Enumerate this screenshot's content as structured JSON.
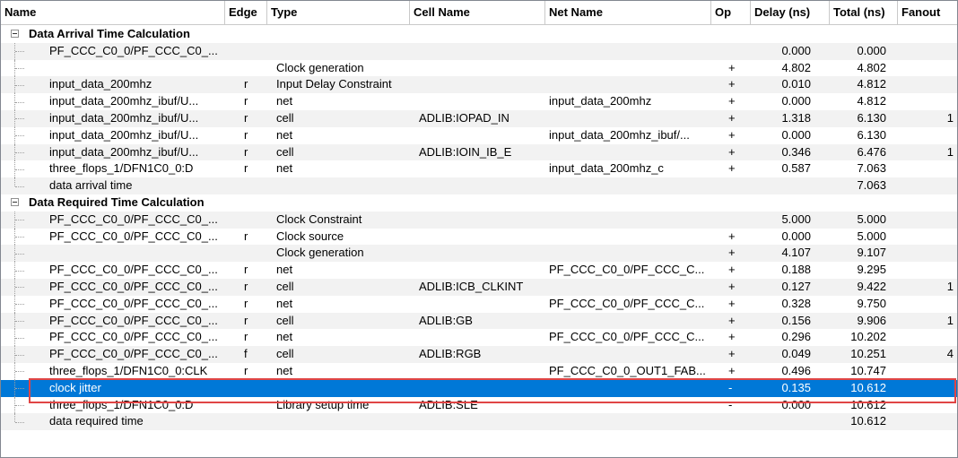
{
  "columns": [
    "Name",
    "Edge",
    "Type",
    "Cell Name",
    "Net Name",
    "Op",
    "Delay (ns)",
    "Total (ns)",
    "Fanout"
  ],
  "groups": [
    {
      "label": "Data Arrival Time Calculation",
      "rows": [
        {
          "name": "PF_CCC_C0_0/PF_CCC_C0_...",
          "edge": "",
          "type": "",
          "cell": "",
          "net": "",
          "op": "",
          "delay": "0.000",
          "total": "0.000",
          "fanout": ""
        },
        {
          "name": "",
          "edge": "",
          "type": "Clock generation",
          "cell": "",
          "net": "",
          "op": "+",
          "delay": "4.802",
          "total": "4.802",
          "fanout": ""
        },
        {
          "name": "input_data_200mhz",
          "edge": "r",
          "type": "Input Delay Constraint",
          "cell": "",
          "net": "",
          "op": "+",
          "delay": "0.010",
          "total": "4.812",
          "fanout": ""
        },
        {
          "name": "input_data_200mhz_ibuf/U...",
          "edge": "r",
          "type": "net",
          "cell": "",
          "net": "input_data_200mhz",
          "op": "+",
          "delay": "0.000",
          "total": "4.812",
          "fanout": ""
        },
        {
          "name": "input_data_200mhz_ibuf/U...",
          "edge": "r",
          "type": "cell",
          "cell": "ADLIB:IOPAD_IN",
          "net": "",
          "op": "+",
          "delay": "1.318",
          "total": "6.130",
          "fanout": "1"
        },
        {
          "name": "input_data_200mhz_ibuf/U...",
          "edge": "r",
          "type": "net",
          "cell": "",
          "net": "input_data_200mhz_ibuf/...",
          "op": "+",
          "delay": "0.000",
          "total": "6.130",
          "fanout": ""
        },
        {
          "name": "input_data_200mhz_ibuf/U...",
          "edge": "r",
          "type": "cell",
          "cell": "ADLIB:IOIN_IB_E",
          "net": "",
          "op": "+",
          "delay": "0.346",
          "total": "6.476",
          "fanout": "1"
        },
        {
          "name": "three_flops_1/DFN1C0_0:D",
          "edge": "r",
          "type": "net",
          "cell": "",
          "net": "input_data_200mhz_c",
          "op": "+",
          "delay": "0.587",
          "total": "7.063",
          "fanout": ""
        },
        {
          "name": "data arrival time",
          "edge": "",
          "type": "",
          "cell": "",
          "net": "",
          "op": "",
          "delay": "",
          "total": "7.063",
          "fanout": ""
        }
      ]
    },
    {
      "label": "Data Required Time Calculation",
      "rows": [
        {
          "name": "PF_CCC_C0_0/PF_CCC_C0_...",
          "edge": "",
          "type": "Clock Constraint",
          "cell": "",
          "net": "",
          "op": "",
          "delay": "5.000",
          "total": "5.000",
          "fanout": ""
        },
        {
          "name": "PF_CCC_C0_0/PF_CCC_C0_...",
          "edge": "r",
          "type": "Clock source",
          "cell": "",
          "net": "",
          "op": "+",
          "delay": "0.000",
          "total": "5.000",
          "fanout": ""
        },
        {
          "name": "",
          "edge": "",
          "type": "Clock generation",
          "cell": "",
          "net": "",
          "op": "+",
          "delay": "4.107",
          "total": "9.107",
          "fanout": ""
        },
        {
          "name": "PF_CCC_C0_0/PF_CCC_C0_...",
          "edge": "r",
          "type": "net",
          "cell": "",
          "net": "PF_CCC_C0_0/PF_CCC_C...",
          "op": "+",
          "delay": "0.188",
          "total": "9.295",
          "fanout": ""
        },
        {
          "name": "PF_CCC_C0_0/PF_CCC_C0_...",
          "edge": "r",
          "type": "cell",
          "cell": "ADLIB:ICB_CLKINT",
          "net": "",
          "op": "+",
          "delay": "0.127",
          "total": "9.422",
          "fanout": "1"
        },
        {
          "name": "PF_CCC_C0_0/PF_CCC_C0_...",
          "edge": "r",
          "type": "net",
          "cell": "",
          "net": "PF_CCC_C0_0/PF_CCC_C...",
          "op": "+",
          "delay": "0.328",
          "total": "9.750",
          "fanout": ""
        },
        {
          "name": "PF_CCC_C0_0/PF_CCC_C0_...",
          "edge": "r",
          "type": "cell",
          "cell": "ADLIB:GB",
          "net": "",
          "op": "+",
          "delay": "0.156",
          "total": "9.906",
          "fanout": "1"
        },
        {
          "name": "PF_CCC_C0_0/PF_CCC_C0_...",
          "edge": "r",
          "type": "net",
          "cell": "",
          "net": "PF_CCC_C0_0/PF_CCC_C...",
          "op": "+",
          "delay": "0.296",
          "total": "10.202",
          "fanout": ""
        },
        {
          "name": "PF_CCC_C0_0/PF_CCC_C0_...",
          "edge": "f",
          "type": "cell",
          "cell": "ADLIB:RGB",
          "net": "",
          "op": "+",
          "delay": "0.049",
          "total": "10.251",
          "fanout": "4"
        },
        {
          "name": "three_flops_1/DFN1C0_0:CLK",
          "edge": "r",
          "type": "net",
          "cell": "",
          "net": "PF_CCC_C0_0_OUT1_FAB...",
          "op": "+",
          "delay": "0.496",
          "total": "10.747",
          "fanout": ""
        },
        {
          "name": "clock jitter",
          "edge": "",
          "type": "",
          "cell": "",
          "net": "",
          "op": "-",
          "delay": "0.135",
          "total": "10.612",
          "fanout": "",
          "selected": true
        },
        {
          "name": "three_flops_1/DFN1C0_0:D",
          "edge": "",
          "type": "Library setup time",
          "cell": "ADLIB:SLE",
          "net": "",
          "op": "-",
          "delay": "0.000",
          "total": "10.612",
          "fanout": ""
        },
        {
          "name": "data required time",
          "edge": "",
          "type": "",
          "cell": "",
          "net": "",
          "op": "",
          "delay": "",
          "total": "10.612",
          "fanout": ""
        }
      ]
    }
  ],
  "colors": {
    "selection": "#0078d7",
    "highlight_border": "#e04545",
    "alt_row": "#f2f2f2"
  }
}
